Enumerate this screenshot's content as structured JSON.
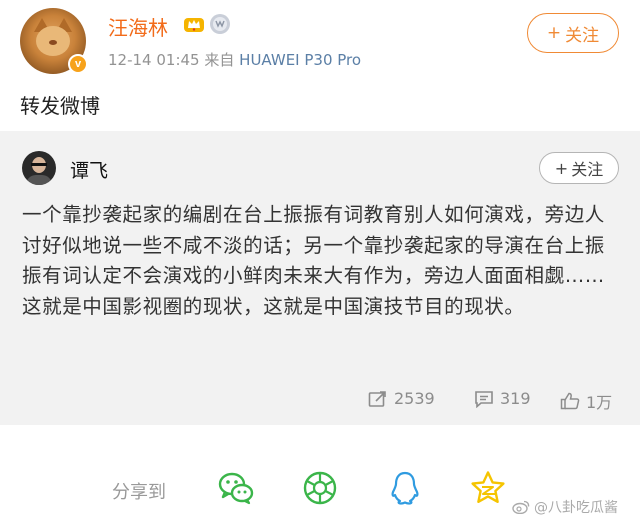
{
  "header": {
    "username": "汪海林",
    "time": "12-14 01:45",
    "from_label": "来自",
    "device": "HUAWEI P30 Pro",
    "follow_label": "关注",
    "verified_badge": "v"
  },
  "post": {
    "text": "转发微博"
  },
  "original": {
    "username": "谭飞",
    "follow_label": "关注",
    "verified_badge": "v",
    "text": "一个靠抄袭起家的编剧在台上振振有词教育别人如何演戏，旁边人讨好似地说一些不咸不淡的话；另一个靠抄袭起家的导演在台上振振有词认定不会演戏的小鲜肉未来大有作为，旁边人面面相觑……这就是中国影视圈的现状，这就是中国演技节目的现状。",
    "reposts": "2539",
    "comments": "319",
    "likes": "1万"
  },
  "share": {
    "label": "分享到",
    "targets": [
      "wechat-icon",
      "moments-icon",
      "qq-icon",
      "qzone-icon"
    ]
  },
  "watermark": {
    "text": "@八卦吃瓜酱"
  },
  "colors": {
    "accent_orange": "#f26b1a",
    "follow_orange": "#f08a35",
    "link_blue": "#5b7fa6",
    "wechat_green": "#3bb54a",
    "qq_blue": "#2f9be0",
    "qzone_yellow": "#f5c400"
  }
}
